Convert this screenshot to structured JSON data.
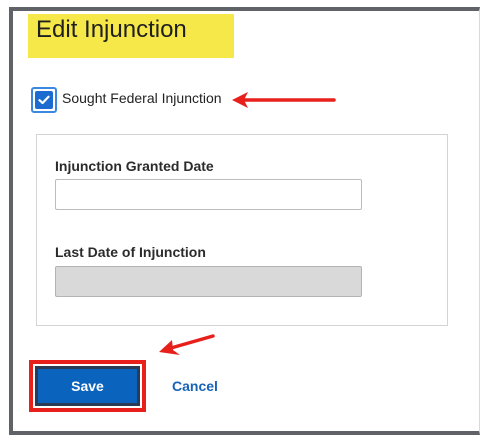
{
  "page": {
    "title": "Edit Injunction"
  },
  "checkbox": {
    "label": "Sought Federal Injunction",
    "checked": true
  },
  "fields": {
    "granted_date": {
      "label": "Injunction Granted Date",
      "value": ""
    },
    "last_date": {
      "label": "Last Date of Injunction",
      "value": "",
      "disabled": true
    }
  },
  "actions": {
    "save_label": "Save",
    "cancel_label": "Cancel"
  },
  "colors": {
    "title_highlight": "#f7e84a",
    "annotation_red": "#e8201c",
    "primary_blue": "#0a63bd",
    "link_blue": "#1763b8"
  },
  "icons": {
    "checkbox": "checkmark-icon",
    "annotation": "arrow-icon"
  }
}
